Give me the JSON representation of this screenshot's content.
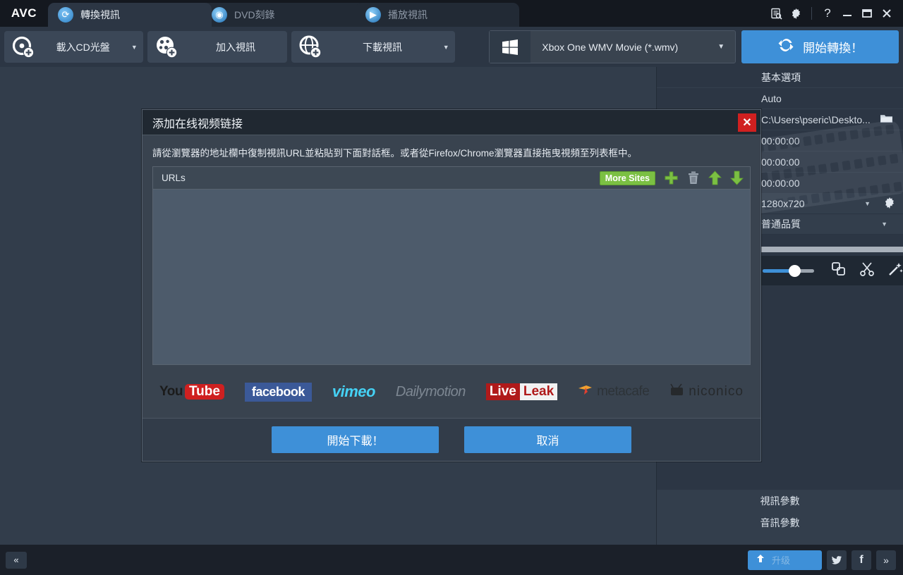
{
  "app": {
    "logo": "AVC",
    "tabs": [
      {
        "label": "轉換視訊",
        "icon": "refresh-icon",
        "active": true
      },
      {
        "label": "DVD刻錄",
        "icon": "disc-icon",
        "active": false
      },
      {
        "label": "播放視訊",
        "icon": "play-icon",
        "active": false
      }
    ],
    "window_controls": [
      {
        "name": "log-icon",
        "glyph": "▤"
      },
      {
        "name": "settings-gear-icon",
        "glyph": "✿"
      },
      {
        "name": "help-icon",
        "glyph": "?"
      },
      {
        "name": "minimize-icon",
        "glyph": "—"
      },
      {
        "name": "maximize-icon",
        "glyph": "❐"
      },
      {
        "name": "close-icon",
        "glyph": "✕"
      }
    ]
  },
  "toolbar": {
    "load_cd_label": "載入CD光盤",
    "add_video_label": "加入視訊",
    "download_video_label": "下載視訊",
    "format_value": "Xbox One WMV Movie (*.wmv)",
    "convert_label": "開始轉換！"
  },
  "right_panel": {
    "basic_options_label": "基本選項",
    "auto_value": "Auto",
    "output_path": "C:\\Users\\pseric\\Deskto...",
    "time_rows": [
      "00:00:00",
      "00:00:00",
      "00:00:00"
    ],
    "resolution": "1280x720",
    "quality": "普通品質",
    "video_params_label": "視訊參數",
    "audio_params_label": "音訊參數"
  },
  "bottom_bar": {
    "collapse_label": "«",
    "upgrade_label": "升级",
    "twitter_label": "t",
    "facebook_label": "f",
    "expand_label": "»"
  },
  "dialog": {
    "title": "添加在线视频链接",
    "description": "請從瀏覽器的地址欄中復制視訊URL並粘貼到下面對話框。或者從Firefox/Chrome瀏覽器直接拖曳視頻至列表框中。",
    "urls_header": "URLs",
    "more_sites_label": "More Sites",
    "actions": [
      {
        "name": "add-url-icon",
        "glyph": "✚",
        "color": "#7bc043"
      },
      {
        "name": "delete-url-icon",
        "glyph": "🗑",
        "color": "#9aa5b0"
      },
      {
        "name": "move-up-icon",
        "glyph": "⬆",
        "color": "#7bc043"
      },
      {
        "name": "move-down-icon",
        "glyph": "⬇",
        "color": "#7bc043"
      }
    ],
    "sites": [
      {
        "name": "youtube",
        "part1": "You",
        "part2": "Tube"
      },
      {
        "name": "facebook",
        "text": "facebook"
      },
      {
        "name": "vimeo",
        "text": "vimeo"
      },
      {
        "name": "dailymotion",
        "part1": "Daily",
        "part2": "motion"
      },
      {
        "name": "liveleak",
        "part1": "Live",
        "part2": "Leak"
      },
      {
        "name": "metacafe",
        "text": "metacafe"
      },
      {
        "name": "niconico",
        "text": "niconico"
      }
    ],
    "start_download_label": "開始下載！",
    "cancel_label": "取消"
  },
  "colors": {
    "accent_blue": "#3e90d8",
    "green": "#7bc043",
    "close_red": "#d02020",
    "panel_bg": "#2c3644",
    "dialog_bg": "#39434f"
  }
}
